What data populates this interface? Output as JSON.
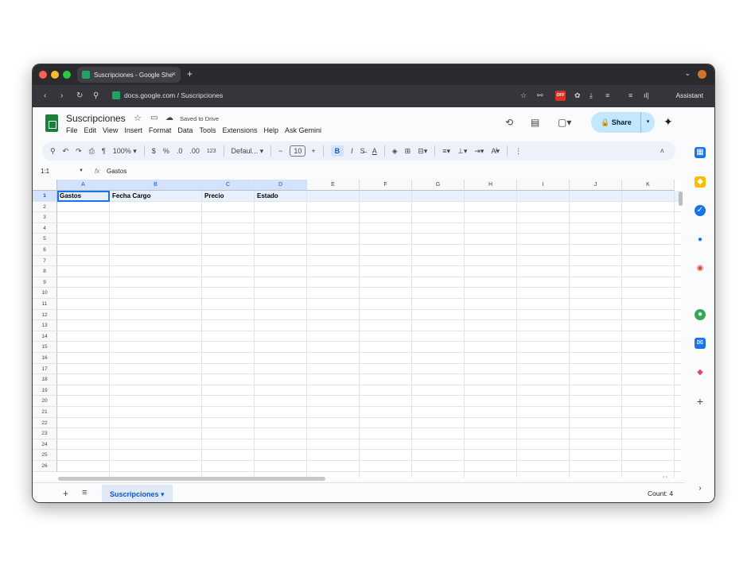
{
  "browser": {
    "tab_title": "Suscripciones - Google She",
    "tab_close": "×",
    "new_tab": "+",
    "url": "docs.google.com / Suscripciones",
    "assistant": "Assistant",
    "extension_badge": "OFF",
    "colors": {
      "close": "#ff5f57",
      "minimize": "#febc2e",
      "maximize": "#28c840"
    }
  },
  "doc": {
    "title": "Suscripciones",
    "saved_status": "Saved to Drive",
    "menus": [
      "File",
      "Edit",
      "View",
      "Insert",
      "Format",
      "Data",
      "Tools",
      "Extensions",
      "Help",
      "Ask Gemini"
    ],
    "share_label": "Share"
  },
  "toolbar": {
    "zoom": "100%",
    "currency": "$",
    "percent": "%",
    "dec_decrease": ".0",
    "dec_increase": ".00",
    "number_format": "123",
    "font": "Defaul...",
    "font_size": "10",
    "bold": "B",
    "italic": "I"
  },
  "formula_bar": {
    "cell_ref": "1:1",
    "fx": "fx",
    "value": "Gastos"
  },
  "grid": {
    "columns": [
      "A",
      "B",
      "C",
      "D",
      "E",
      "F",
      "G",
      "H",
      "I",
      "J",
      "K"
    ],
    "rows": [
      "1",
      "2",
      "3",
      "4",
      "5",
      "6",
      "7",
      "8",
      "9",
      "10",
      "11",
      "12",
      "13",
      "14",
      "15",
      "16",
      "17",
      "18",
      "19",
      "20",
      "21",
      "22",
      "23",
      "24",
      "25",
      "26"
    ],
    "header_row": [
      "Gastos",
      "Fecha Cargo",
      "Precio",
      "Estado"
    ]
  },
  "bottom": {
    "sheet_name": "Suscripciones",
    "count": "Count: 4"
  },
  "accent_color": "#0b57d0"
}
